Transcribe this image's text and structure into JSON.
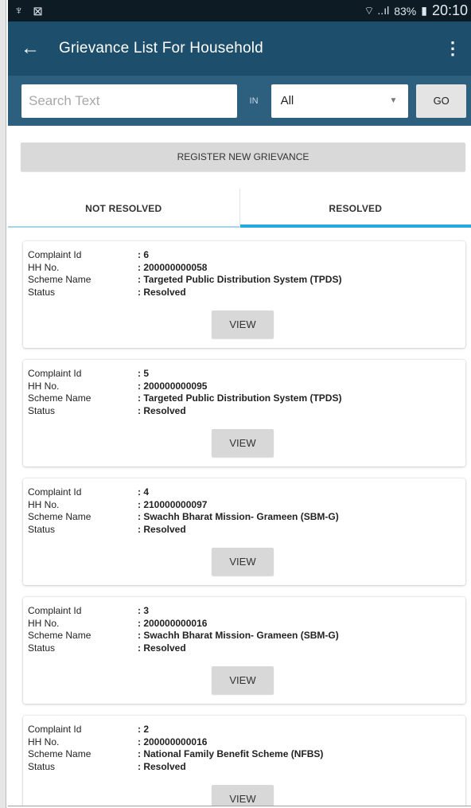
{
  "status_bar": {
    "left_icons": [
      "usb-icon",
      "notification-icon"
    ],
    "usb_glyph": "♆",
    "notif_glyph": "⊠",
    "signal_glyph": "⌔ ..ıl",
    "battery": "83%",
    "battery_glyph": "▮",
    "time": "20:10"
  },
  "app_bar": {
    "back_glyph": "←",
    "title": "Grievance List For Household",
    "more_glyph": "⋮"
  },
  "search": {
    "placeholder": "Search Text",
    "value": "",
    "in_label": "IN",
    "filter_selected": "All",
    "go_label": "GO"
  },
  "register_label": "REGISTER NEW GRIEVANCE",
  "tabs": [
    {
      "label": "NOT RESOLVED",
      "active": false
    },
    {
      "label": "RESOLVED",
      "active": true
    }
  ],
  "field_labels": {
    "complaint_id": "Complaint Id",
    "hh_no": "HH No.",
    "scheme_name": "Scheme Name",
    "status": "Status"
  },
  "view_label": "VIEW",
  "complaints": [
    {
      "complaint_id": ": 6",
      "hh_no": ": 200000000058",
      "scheme_name": ": Targeted Public Distribution System (TPDS)",
      "status": ": Resolved"
    },
    {
      "complaint_id": ": 5",
      "hh_no": ": 200000000095",
      "scheme_name": ": Targeted Public Distribution System (TPDS)",
      "status": ": Resolved"
    },
    {
      "complaint_id": ": 4",
      "hh_no": ": 210000000097",
      "scheme_name": ": Swachh Bharat Mission- Grameen (SBM-G)",
      "status": ": Resolved"
    },
    {
      "complaint_id": ": 3",
      "hh_no": ": 200000000016",
      "scheme_name": ": Swachh Bharat Mission- Grameen (SBM-G)",
      "status": ": Resolved"
    },
    {
      "complaint_id": ": 2",
      "hh_no": ": 200000000016",
      "scheme_name": ": National Family Benefit Scheme (NFBS)",
      "status": ": Resolved"
    }
  ],
  "colors": {
    "app_bar": "#1d4e6b",
    "search_bar": "#2d5f7f",
    "tab_indicator": "#27a9e0"
  }
}
